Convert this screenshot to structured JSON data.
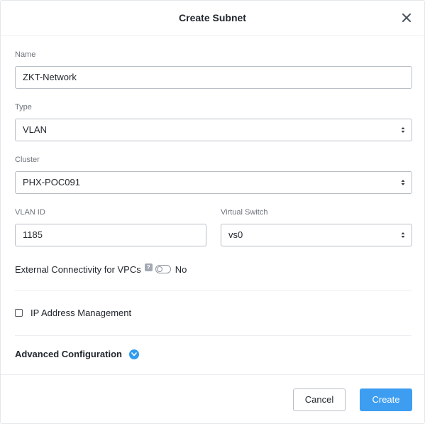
{
  "dialog": {
    "title": "Create Subnet",
    "close_icon": "close-icon"
  },
  "form": {
    "name": {
      "label": "Name",
      "value": "ZKT-Network"
    },
    "type": {
      "label": "Type",
      "value": "VLAN"
    },
    "cluster": {
      "label": "Cluster",
      "value": "PHX-POC091"
    },
    "vlan_id": {
      "label": "VLAN ID",
      "value": "1185"
    },
    "virtual_switch": {
      "label": "Virtual Switch",
      "value": "vs0"
    },
    "external_connectivity": {
      "label": "External Connectivity for VPCs",
      "help_glyph": "?",
      "toggle_state": "No",
      "enabled": false
    },
    "ip_address_management": {
      "label": "IP Address Management",
      "checked": false
    },
    "advanced_configuration": {
      "label": "Advanced Configuration",
      "icon": "chevron-down-circle-icon"
    }
  },
  "footer": {
    "cancel_label": "Cancel",
    "create_label": "Create"
  },
  "colors": {
    "primary": "#3d9df0",
    "border": "#b8bec6",
    "text": "#22272e",
    "muted": "#6c727a"
  }
}
